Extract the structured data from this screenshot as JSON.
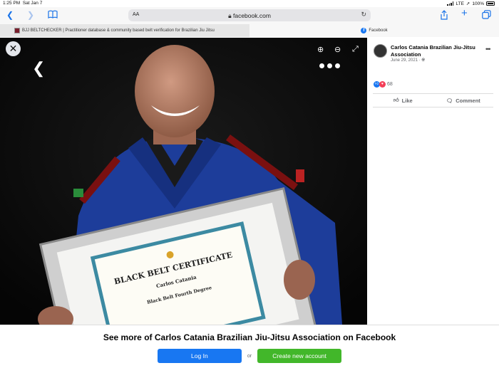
{
  "statusbar": {
    "time": "1:25 PM",
    "date": "Sat Jan 7",
    "network": "LTE",
    "battery": "100%"
  },
  "browser": {
    "text_size_label": "AA",
    "url": "facebook.com",
    "tabs": [
      {
        "title": "BJJ BELTCHECKER | Practitioner database & community based belt verification for Brazilian Jiu Jitsu"
      },
      {
        "title": "Facebook"
      }
    ]
  },
  "viewer": {
    "icons": [
      "close-icon",
      "back-arrow-icon",
      "zoom-in-icon",
      "zoom-out-icon",
      "expand-icon",
      "more-icon"
    ]
  },
  "post": {
    "page_name": "Carlos Catania Brazilian Jiu-Jitsu Association",
    "date": "June 29, 2021 · ",
    "reaction_count": "68",
    "like_label": "Like",
    "comment_label": "Comment"
  },
  "footer": {
    "see_more": "See more of Carlos Catania Brazilian Jiu-Jitsu Association on Facebook",
    "login_label": "Log In",
    "or_label": "or",
    "create_label": "Create new account"
  },
  "colors": {
    "facebook_blue": "#1877f2",
    "create_green": "#42b72a",
    "photo_bg": "#0b0b0b",
    "safari_blue": "#1a73e8"
  }
}
